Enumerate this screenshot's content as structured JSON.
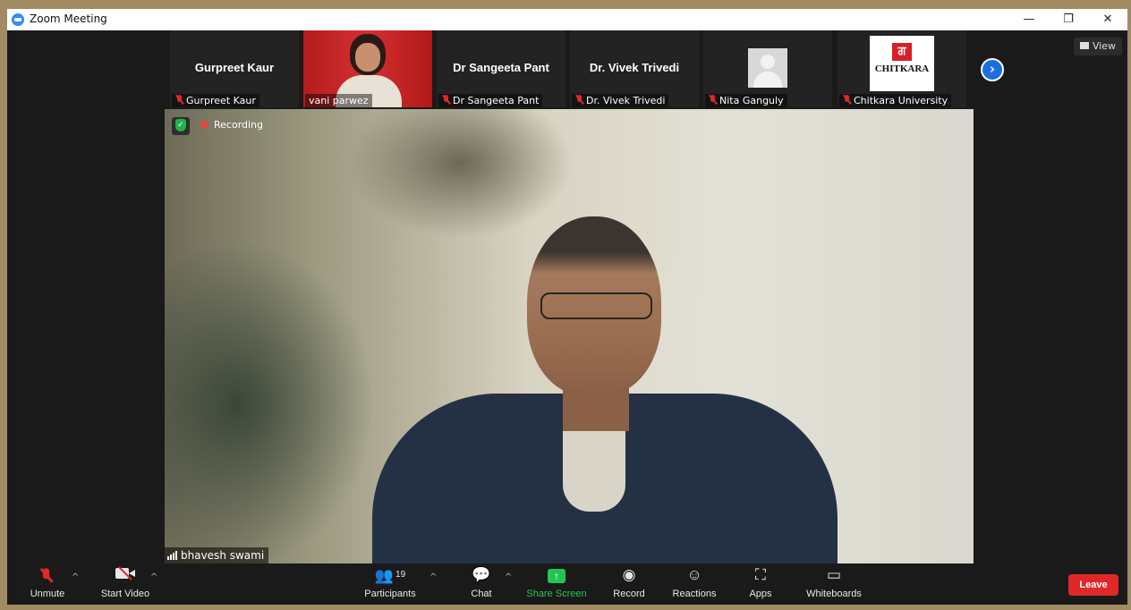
{
  "window": {
    "title": "Zoom Meeting",
    "controls": {
      "minimize": "—",
      "restore": "❐",
      "close": "✕"
    }
  },
  "participants_strip": [
    {
      "display_name": "Gurpreet Kaur",
      "label": "Gurpreet Kaur",
      "muted": true,
      "type": "name"
    },
    {
      "label": "vani parwez",
      "muted": false,
      "type": "video"
    },
    {
      "display_name": "Dr Sangeeta Pant",
      "label": "Dr Sangeeta Pant",
      "muted": true,
      "type": "name"
    },
    {
      "display_name": "Dr. Vivek Trivedi",
      "label": "Dr. Vivek Trivedi",
      "muted": true,
      "type": "name"
    },
    {
      "label": "Nita Ganguly",
      "muted": true,
      "type": "avatar"
    },
    {
      "label": "Chitkara University",
      "muted": true,
      "type": "logo",
      "logo_text": "CHITKARA",
      "logo_mark": "ਗ"
    }
  ],
  "next_page_icon": "chevron-right-icon",
  "view_button": {
    "label": "View",
    "icon": "grid-icon"
  },
  "main_video": {
    "recording_label": "Recording",
    "speaker_name": "bhavesh swami",
    "security_icon": "shield-check-icon"
  },
  "toolbar": {
    "unmute": "Unmute",
    "start_video": "Start Video",
    "participants": "Participants",
    "participants_count": "19",
    "chat": "Chat",
    "share_screen": "Share Screen",
    "record": "Record",
    "reactions": "Reactions",
    "apps": "Apps",
    "whiteboards": "Whiteboards",
    "leave": "Leave"
  },
  "colors": {
    "accent_blue": "#1a6fe0",
    "leave_red": "#e02828",
    "share_green": "#23c552",
    "muted_red": "#e02828"
  }
}
